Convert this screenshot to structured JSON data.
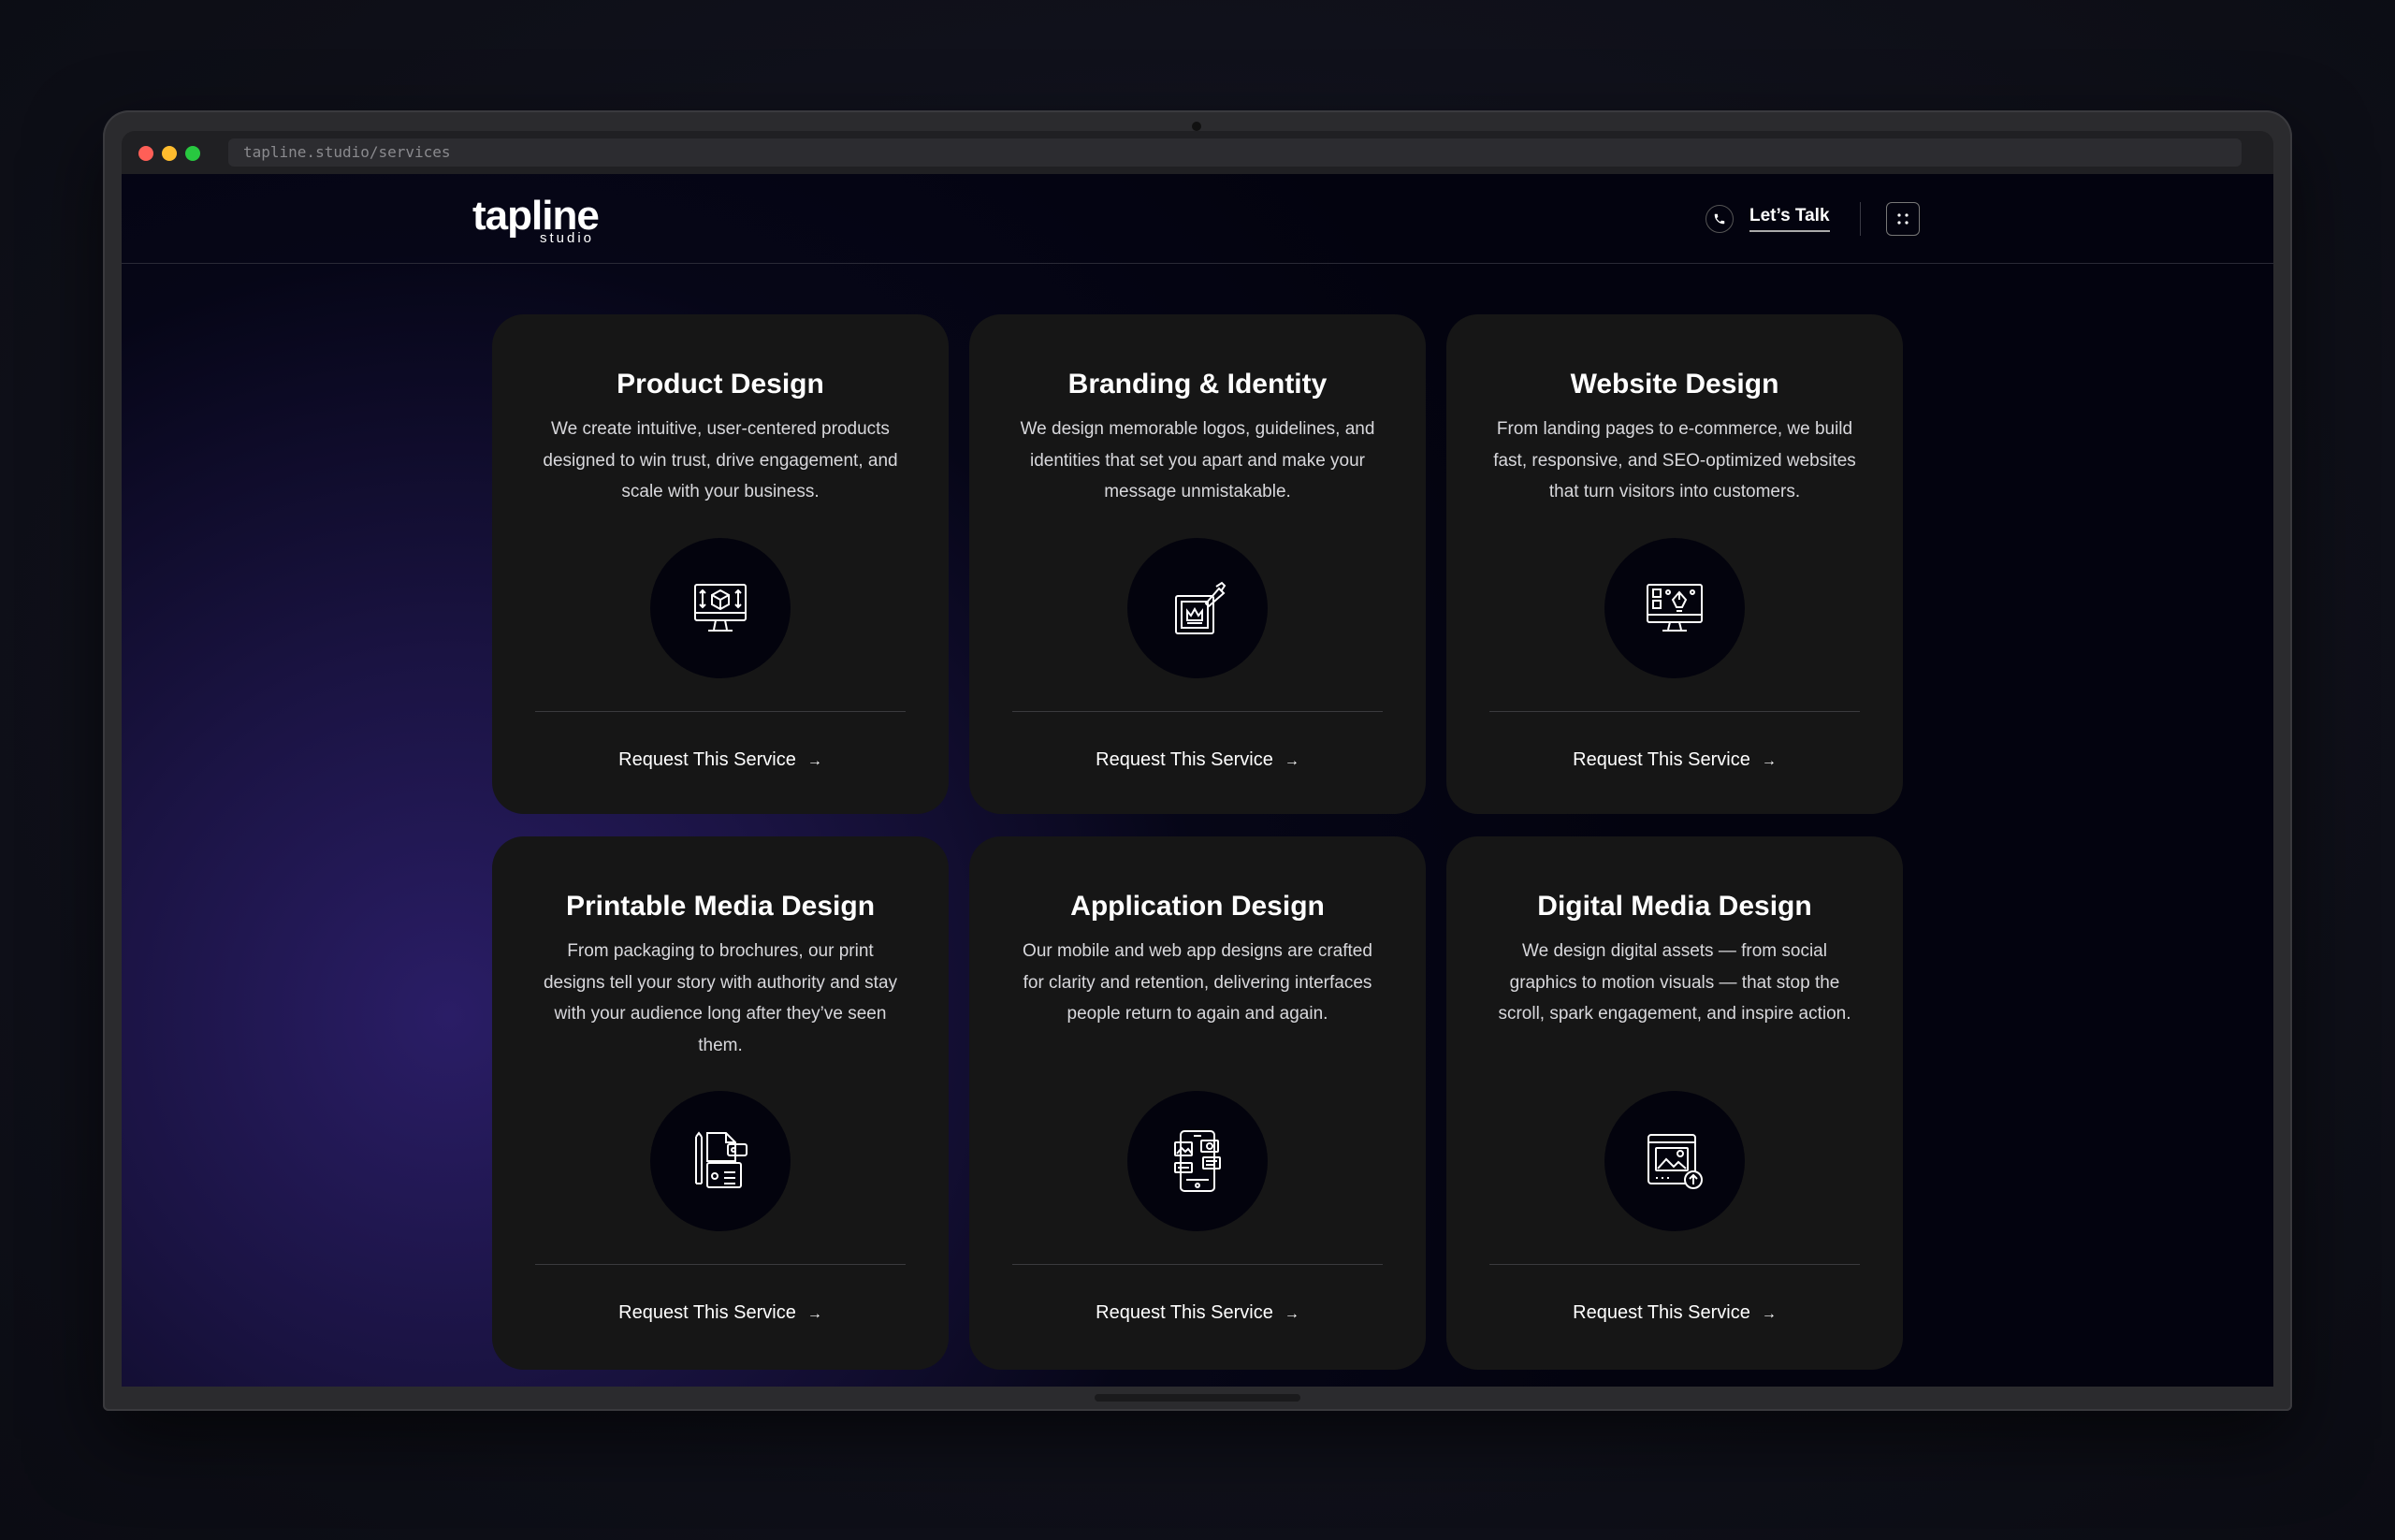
{
  "browser": {
    "url": "tapline.studio/services"
  },
  "header": {
    "logo_word": "tapline",
    "logo_sub": "studio",
    "cta_label": "Let’s Talk"
  },
  "cards": [
    {
      "title": "Product Design",
      "desc": "We create intuitive, user-centered products designed to win trust, drive engagement, and scale with your business.",
      "cta": "Request This Service",
      "icon": "monitor-3d-box-icon"
    },
    {
      "title": "Branding & Identity",
      "desc": "We design memorable logos, guidelines, and identities that set you apart and make your message unmistakable.",
      "cta": "Request This Service",
      "icon": "crown-pen-frame-icon"
    },
    {
      "title": "Website Design",
      "desc": "From landing pages to e-commerce, we build fast, responsive, and SEO-optimized websites that turn visitors into customers.",
      "cta": "Request This Service",
      "icon": "monitor-pen-tool-icon"
    },
    {
      "title": "Printable Media Design",
      "desc": "From packaging to brochures, our print designs tell your story with authority and stay with your audience long after they’ve seen them.",
      "cta": "Request This Service",
      "icon": "print-media-icon"
    },
    {
      "title": "Application Design",
      "desc": "Our mobile and web app designs are crafted for clarity and retention, delivering interfaces people return to again and again.",
      "cta": "Request This Service",
      "icon": "mobile-app-icon"
    },
    {
      "title": "Digital Media Design",
      "desc": "We design digital assets — from social graphics to motion visuals — that stop the scroll, spark engagement, and inspire action.",
      "cta": "Request This Service",
      "icon": "digital-image-upload-icon"
    }
  ]
}
